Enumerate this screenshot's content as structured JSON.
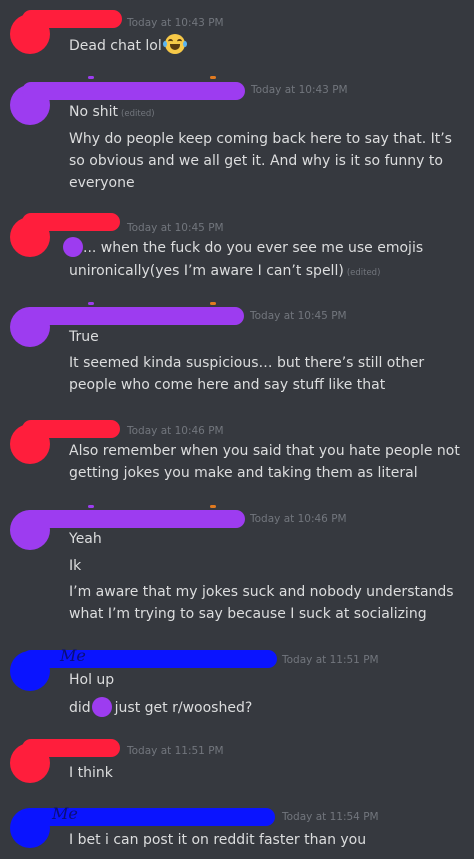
{
  "colors": {
    "red": "#ff1e3c",
    "purple": "#9d3cf0",
    "blue": "#0a14ff",
    "background": "#36393f",
    "timestamp": "#72767d"
  },
  "messages": [
    {
      "author_color": "red",
      "timestamp": "Today at 10:43 PM",
      "lines": [
        "Dead chat lol"
      ],
      "emoji": "joy-emoji"
    },
    {
      "author_color": "purple",
      "timestamp": "Today at 10:43 PM",
      "lines": [
        "No shit",
        "Why do people keep coming back here to say that. It’s",
        "so obvious and we all get it. And why is it so funny to",
        "everyone"
      ],
      "edited": "(edited)"
    },
    {
      "author_color": "red",
      "timestamp": "Today at 10:45 PM",
      "lines": [
        "... when the fuck do you ever see me use emojis",
        "unironically(yes I’m aware I can’t spell)"
      ],
      "edited": "(edited)"
    },
    {
      "author_color": "purple",
      "timestamp": "Today at 10:45 PM",
      "lines": [
        "True",
        "It seemed kinda suspicious… but there’s still other",
        "people who come here and say stuff like that"
      ]
    },
    {
      "author_color": "red",
      "timestamp": "Today at 10:46 PM",
      "lines": [
        "Also remember when you said that you hate people not",
        "getting jokes you make and taking them as literal"
      ]
    },
    {
      "author_color": "purple",
      "timestamp": "Today at 10:46 PM",
      "lines": [
        "Yeah",
        "Ik",
        "I’m aware that my jokes suck and nobody understands",
        "what I’m trying to say because I suck at socializing"
      ]
    },
    {
      "author_color": "blue",
      "author_tag": "Me",
      "timestamp": "Today at 11:51 PM",
      "lines": [
        "Hol up",
        "did",
        "just get r/wooshed?"
      ]
    },
    {
      "author_color": "red",
      "timestamp": "Today at 11:51 PM",
      "lines": [
        "I think"
      ]
    },
    {
      "author_color": "blue",
      "author_tag": "Me",
      "timestamp": "Today at 11:54 PM",
      "lines": [
        "I bet i can post it on reddit faster than you"
      ]
    }
  ]
}
